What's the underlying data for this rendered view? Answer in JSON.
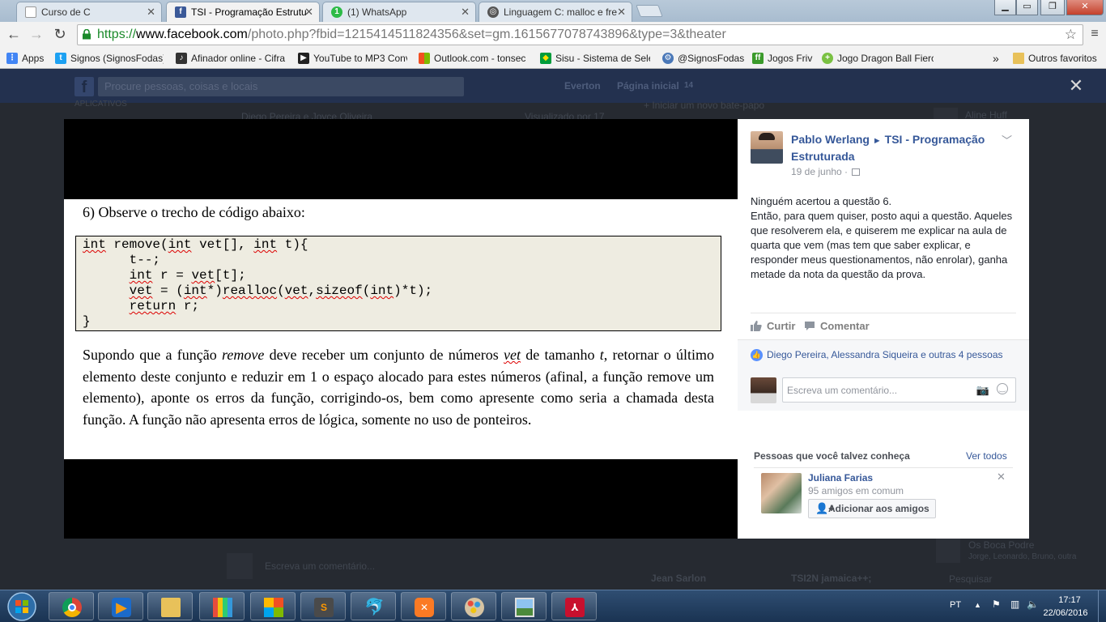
{
  "browser": {
    "tabs": [
      {
        "label": "Curso de C",
        "icon": "document-icon"
      },
      {
        "label": "TSI - Programação Estrutu",
        "icon": "facebook-icon"
      },
      {
        "label": "(1) WhatsApp",
        "icon": "whatsapp-icon"
      },
      {
        "label": "Linguagem C: malloc e fre",
        "icon": "page-icon"
      }
    ],
    "url": {
      "scheme": "https://",
      "host": "www.facebook.com",
      "path": "/photo.php?fbid=1215414511824356&set=gm.1615677078743896&type=3&theater"
    },
    "bookmarks": [
      {
        "label": "Apps",
        "icon": "apps-grid-icon",
        "color": "#4285f4"
      },
      {
        "label": "Signos (SignosFodas)",
        "icon": "twitter-bird-icon",
        "color": "#1da1f2"
      },
      {
        "label": "Afinador online - Cifra",
        "icon": "guitar-icon",
        "color": "#333333"
      },
      {
        "label": "YouTube to MP3 Conv",
        "icon": "download-icon",
        "color": "#222222"
      },
      {
        "label": "Outlook.com - tonsec",
        "icon": "windows-logo-icon",
        "color": "#f25022"
      },
      {
        "label": "Sisu - Sistema de Sele",
        "icon": "brazil-flag-icon",
        "color": "#009c3b"
      },
      {
        "label": "@SignosFodas",
        "icon": "gear-icon",
        "color": "#4a78b8"
      },
      {
        "label": "Jogos Friv",
        "icon": "friv-icon",
        "color": "#3a9a2a"
      },
      {
        "label": "Jogo Dragon Ball Fierc",
        "icon": "dragon-ball-icon",
        "color": "#7ac143"
      }
    ],
    "bookmarks_more": "»",
    "other_bookmarks": "Outros favoritos"
  },
  "facebook_bg": {
    "search_placeholder": "Procure pessoas, coisas e locais",
    "user_name": "Everton",
    "home_label": "Página inicial",
    "home_count": "14",
    "apps_label": "APLICATIVOS",
    "group_header": "Diego Pereira e Joyce Oliveira",
    "seen_label": "Visualizado por 17",
    "new_chat": "+ Iniciar um novo bate-papo",
    "chat_1": "Aline Huff",
    "chat_2": "Jean Sarlon",
    "chat_3": "TSI2N jamaica++;",
    "chat_4": "Os Boca Podre",
    "chat_4_sub": "Jorge, Leonardo, Bruno, outra",
    "comment_placeholder": "Escreva um comentário...",
    "chat_search": "Pesquisar"
  },
  "photo": {
    "question_title": "6)   Observe o trecho de código abaixo:",
    "code_lines": [
      "int remove(int vet[], int t){",
      "      t--;",
      "      int r = vet[t];",
      "      vet = (int*)realloc(vet,sizeof(int)*t);",
      "      return r;",
      "}"
    ],
    "body_1": "Supondo que a função ",
    "body_em_1": "remove",
    "body_2": " deve receber um conjunto de números ",
    "body_em_2": "vet",
    "body_3": " de tamanho ",
    "body_em_3": "t",
    "body_4": ", retornar o último elemento deste conjunto e reduzir em 1 o espaço alocado para estes números (afinal, a função remove um elemento), aponte os erros da função, corrigindo-os, bem como apresente como seria a chamada desta função. A função não apresenta erros de lógica, somente no uso de ponteiros."
  },
  "post": {
    "author": "Pablo Werlang",
    "arrow": "►",
    "group": "TSI - Programação Estruturada",
    "date": "19 de junho ·",
    "body_lines": [
      "Ninguém acertou a questão 6.",
      "Então, para quem quiser, posto aqui a questão. Aqueles que resolverem ela, e quiserem me explicar na aula de quarta que vem (mas tem que saber explicar, e responder meus questionamentos, não enrolar), ganha metade da nota da questão da prova."
    ],
    "like_label": "Curtir",
    "comment_label": "Comentar",
    "likes_text": "Diego Pereira, Alessandra Siqueira e outras 4 pessoas",
    "comment_placeholder": "Escreva um comentário..."
  },
  "pymk": {
    "title": "Pessoas que você talvez conheça",
    "see_all": "Ver todos",
    "name": "Juliana Farias",
    "mutual": "95 amigos em comum",
    "add_label": "Adicionar aos amigos"
  },
  "taskbar": {
    "apps": [
      "chrome-icon",
      "media-player-icon",
      "explorer-folder-icon",
      "apps-grid-icon",
      "office-icon",
      "sublime-text-icon",
      "mysql-icon",
      "xampp-icon",
      "paint-icon",
      "photo-viewer-icon",
      "pdf-reader-icon"
    ],
    "language": "PT",
    "time": "17:17",
    "date": "22/06/2016"
  },
  "colors": {
    "fb_blue": "#365899",
    "chrome_ssl_green": "#1a8a2a",
    "code_bg": "#eeece1",
    "squiggle": "#dd0000",
    "taskbar": "#1a3352"
  }
}
